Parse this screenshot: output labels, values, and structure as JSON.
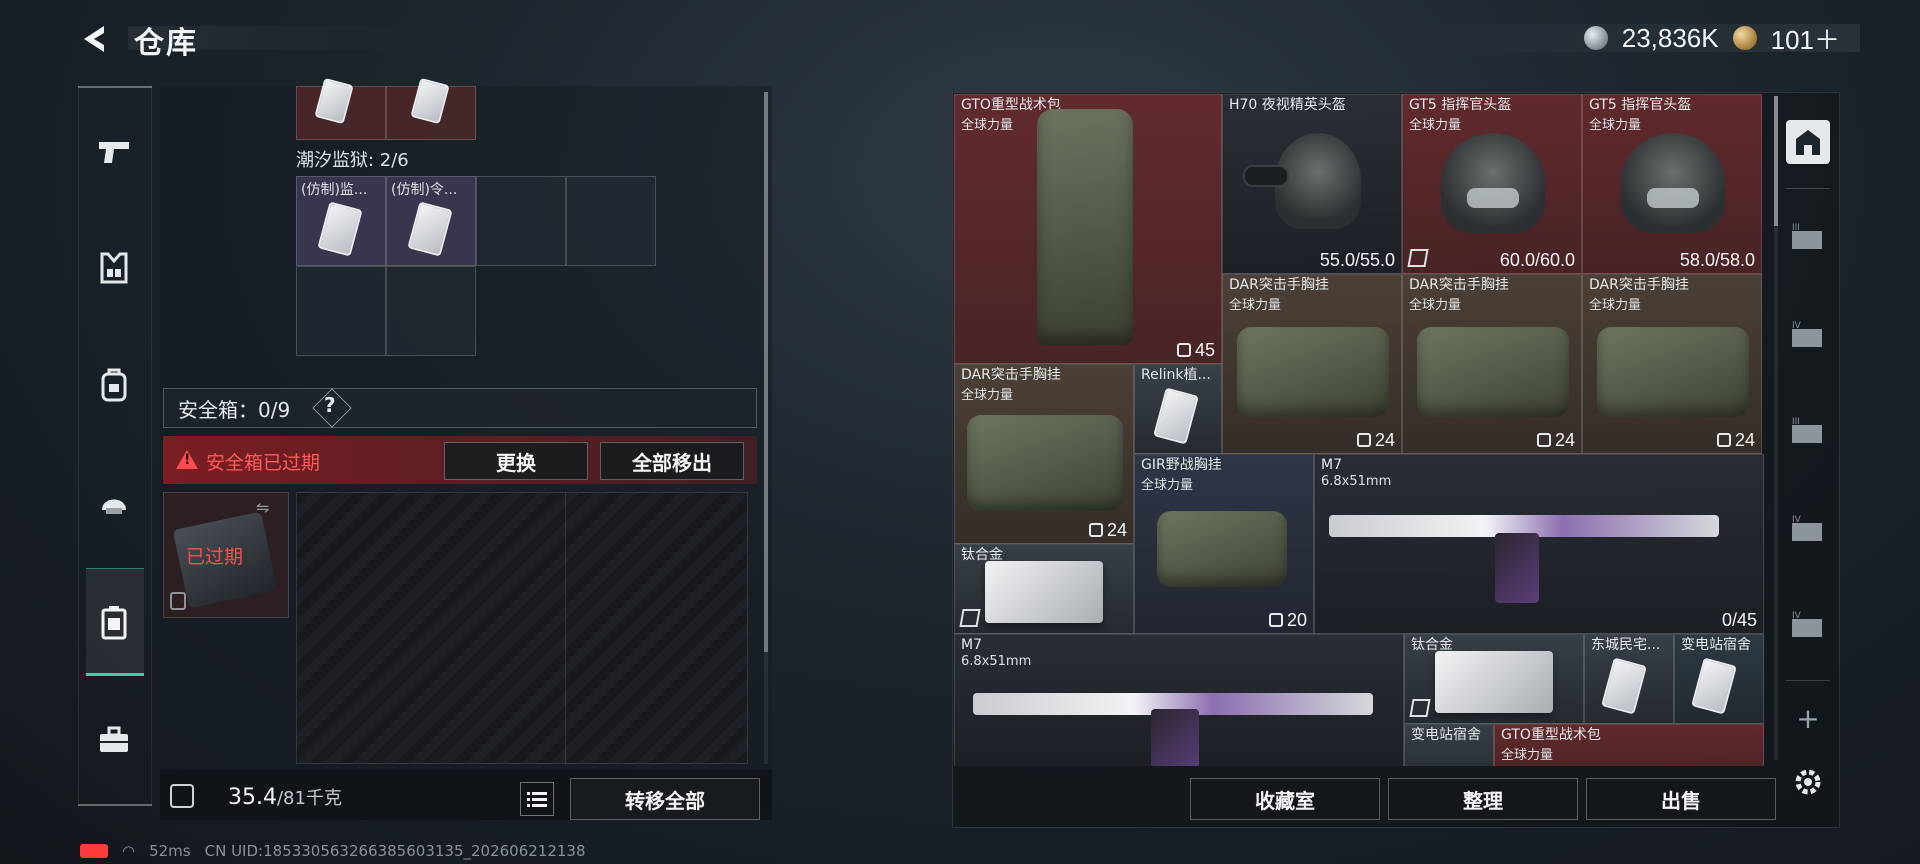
{
  "header": {
    "title": "仓库",
    "currency_silver": "23,836K",
    "currency_gold": "101＋"
  },
  "rail": {
    "items": [
      "weapons-icon",
      "armor-icon",
      "backpack-icon",
      "helmet-icon",
      "safebox-icon",
      "toolbox-icon"
    ]
  },
  "left": {
    "top_grid_label": "潮汐监狱: 2/6",
    "card1_label": "(仿制)监...",
    "card2_label": "(仿制)令...",
    "safe_label": "安全箱：0/9",
    "help": "?",
    "expired_warning": "安全箱已过期",
    "replace_btn": "更换",
    "remove_all_btn": "全部移出",
    "case_expired": "已过期",
    "weight": "35.4",
    "weight_max": "/81千克",
    "transfer_all_btn": "转移全部"
  },
  "stash": {
    "items": {
      "gto_pack": {
        "name": "GTO重型战术包",
        "sub": "全球力量",
        "value": "45"
      },
      "h70": {
        "name": "H70 夜视精英头盔",
        "value": "55.0/55.0"
      },
      "gt5_a": {
        "name": "GT5 指挥官头盔",
        "sub": "全球力量",
        "value": "60.0/60.0"
      },
      "gt5_b": {
        "name": "GT5 指挥官头盔",
        "sub": "全球力量",
        "value": "58.0/58.0"
      },
      "dar_a": {
        "name": "DAR突击手胸挂",
        "sub": "全球力量",
        "value": "24"
      },
      "dar_b": {
        "name": "DAR突击手胸挂",
        "sub": "全球力量",
        "value": "24"
      },
      "dar_c": {
        "name": "DAR突击手胸挂",
        "sub": "全球力量",
        "value": "24"
      },
      "dar_d": {
        "name": "DAR突击手胸挂",
        "sub": "全球力量",
        "value": "24"
      },
      "relink": {
        "name": "Relink植..."
      },
      "gir": {
        "name": "GIR野战胸挂",
        "sub": "全球力量",
        "value": "20"
      },
      "m7_a": {
        "name": "M7",
        "sub": "6.8x51mm",
        "value": "0/45"
      },
      "titanium_a": {
        "name": "钛合金"
      },
      "m7_b": {
        "name": "M7",
        "sub": "6.8x51mm"
      },
      "titanium_b": {
        "name": "钛合金"
      },
      "dongcheng": {
        "name": "东城民宅..."
      },
      "substation_a": {
        "name": "变电站宿舍"
      },
      "substation_b": {
        "name": "变电站宿舍"
      },
      "gto_pack_b": {
        "name": "GTO重型战术包",
        "sub": "全球力量"
      }
    }
  },
  "bottom": {
    "collection_btn": "收藏室",
    "sort_btn": "整理",
    "sell_btn": "出售"
  },
  "status": {
    "ping": "52ms",
    "uid": "CN UID:18533056326638560313​5_202606212138"
  }
}
